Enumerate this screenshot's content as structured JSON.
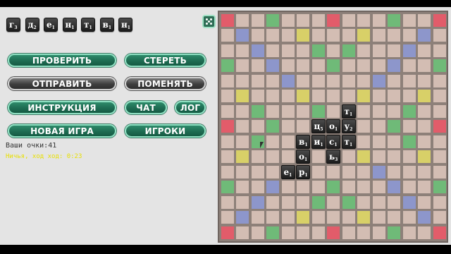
{
  "rack": [
    {
      "letter": "г",
      "value": "3"
    },
    {
      "letter": "д",
      "value": "2"
    },
    {
      "letter": "е",
      "value": "1"
    },
    {
      "letter": "н",
      "value": "1"
    },
    {
      "letter": "т",
      "value": "1"
    },
    {
      "letter": "в",
      "value": "1"
    },
    {
      "letter": "н",
      "value": "1"
    }
  ],
  "buttons": {
    "check": "ПРОВЕРИТЬ",
    "erase": "СТЕРЕТЬ",
    "send": "ОТПРАВИТЬ",
    "swap": "ПОМЕНЯТЬ",
    "instructions": "ИНСТРУКЦИЯ",
    "chat": "ЧАТ",
    "log": "ЛОГ",
    "new_game": "НОВАЯ ИГРА",
    "players": "ИГРОКИ"
  },
  "score_label": "Ваши очки:41",
  "move_label": "Ничья, ход ход: 0:23",
  "colors": {
    "cell": "#d3bdb3",
    "red": "#e25c6a",
    "blue": "#8d96cb",
    "green": "#6fba78",
    "yellow": "#d8d068",
    "accent_green": "#1e6c52"
  },
  "board": {
    "size": 15,
    "premium": [
      [
        "R",
        ".",
        ".",
        "G",
        ".",
        ".",
        ".",
        "R",
        ".",
        ".",
        ".",
        "G",
        ".",
        ".",
        "R"
      ],
      [
        ".",
        "B",
        ".",
        ".",
        ".",
        "Y",
        ".",
        ".",
        ".",
        "Y",
        ".",
        ".",
        ".",
        "B",
        "."
      ],
      [
        ".",
        ".",
        "B",
        ".",
        ".",
        ".",
        "G",
        ".",
        "G",
        ".",
        ".",
        ".",
        "B",
        ".",
        "."
      ],
      [
        "G",
        ".",
        ".",
        "B",
        ".",
        ".",
        ".",
        "G",
        ".",
        ".",
        ".",
        "B",
        ".",
        ".",
        "G"
      ],
      [
        ".",
        ".",
        ".",
        ".",
        "B",
        ".",
        ".",
        ".",
        ".",
        ".",
        "B",
        ".",
        ".",
        ".",
        "."
      ],
      [
        ".",
        "Y",
        ".",
        ".",
        ".",
        "Y",
        ".",
        ".",
        ".",
        "Y",
        ".",
        ".",
        ".",
        "Y",
        "."
      ],
      [
        ".",
        ".",
        "G",
        ".",
        ".",
        ".",
        "G",
        ".",
        "G",
        ".",
        ".",
        ".",
        "G",
        ".",
        "."
      ],
      [
        "R",
        ".",
        ".",
        "G",
        ".",
        ".",
        ".",
        "G",
        ".",
        ".",
        ".",
        "G",
        ".",
        ".",
        "R"
      ],
      [
        ".",
        ".",
        "G",
        ".",
        ".",
        ".",
        "G",
        ".",
        "G",
        ".",
        ".",
        ".",
        "G",
        ".",
        "."
      ],
      [
        ".",
        "Y",
        ".",
        ".",
        ".",
        "Y",
        ".",
        ".",
        ".",
        "Y",
        ".",
        ".",
        ".",
        "Y",
        "."
      ],
      [
        ".",
        ".",
        ".",
        ".",
        "B",
        ".",
        ".",
        ".",
        ".",
        ".",
        "B",
        ".",
        ".",
        ".",
        "."
      ],
      [
        "G",
        ".",
        ".",
        "B",
        ".",
        ".",
        ".",
        "G",
        ".",
        ".",
        ".",
        "B",
        ".",
        ".",
        "G"
      ],
      [
        ".",
        ".",
        "B",
        ".",
        ".",
        ".",
        "G",
        ".",
        "G",
        ".",
        ".",
        ".",
        "B",
        ".",
        "."
      ],
      [
        ".",
        "B",
        ".",
        ".",
        ".",
        "Y",
        ".",
        ".",
        ".",
        "Y",
        ".",
        ".",
        ".",
        "B",
        "."
      ],
      [
        "R",
        ".",
        ".",
        "G",
        ".",
        ".",
        ".",
        "R",
        ".",
        ".",
        ".",
        "G",
        ".",
        ".",
        "R"
      ]
    ],
    "tiles": [
      {
        "row": 6,
        "col": 8,
        "letter": "т",
        "value": "1"
      },
      {
        "row": 7,
        "col": 6,
        "letter": "ц",
        "value": "5"
      },
      {
        "row": 7,
        "col": 7,
        "letter": "о",
        "value": "1"
      },
      {
        "row": 7,
        "col": 8,
        "letter": "у",
        "value": "2"
      },
      {
        "row": 8,
        "col": 5,
        "letter": "в",
        "value": "1"
      },
      {
        "row": 8,
        "col": 6,
        "letter": "и",
        "value": "1"
      },
      {
        "row": 8,
        "col": 7,
        "letter": "с",
        "value": "1"
      },
      {
        "row": 8,
        "col": 8,
        "letter": "т",
        "value": "1"
      },
      {
        "row": 9,
        "col": 5,
        "letter": "о",
        "value": "1"
      },
      {
        "row": 9,
        "col": 7,
        "letter": "ь",
        "value": "3"
      },
      {
        "row": 10,
        "col": 4,
        "letter": "е",
        "value": "1"
      },
      {
        "row": 10,
        "col": 5,
        "letter": "р",
        "value": "1"
      }
    ]
  }
}
